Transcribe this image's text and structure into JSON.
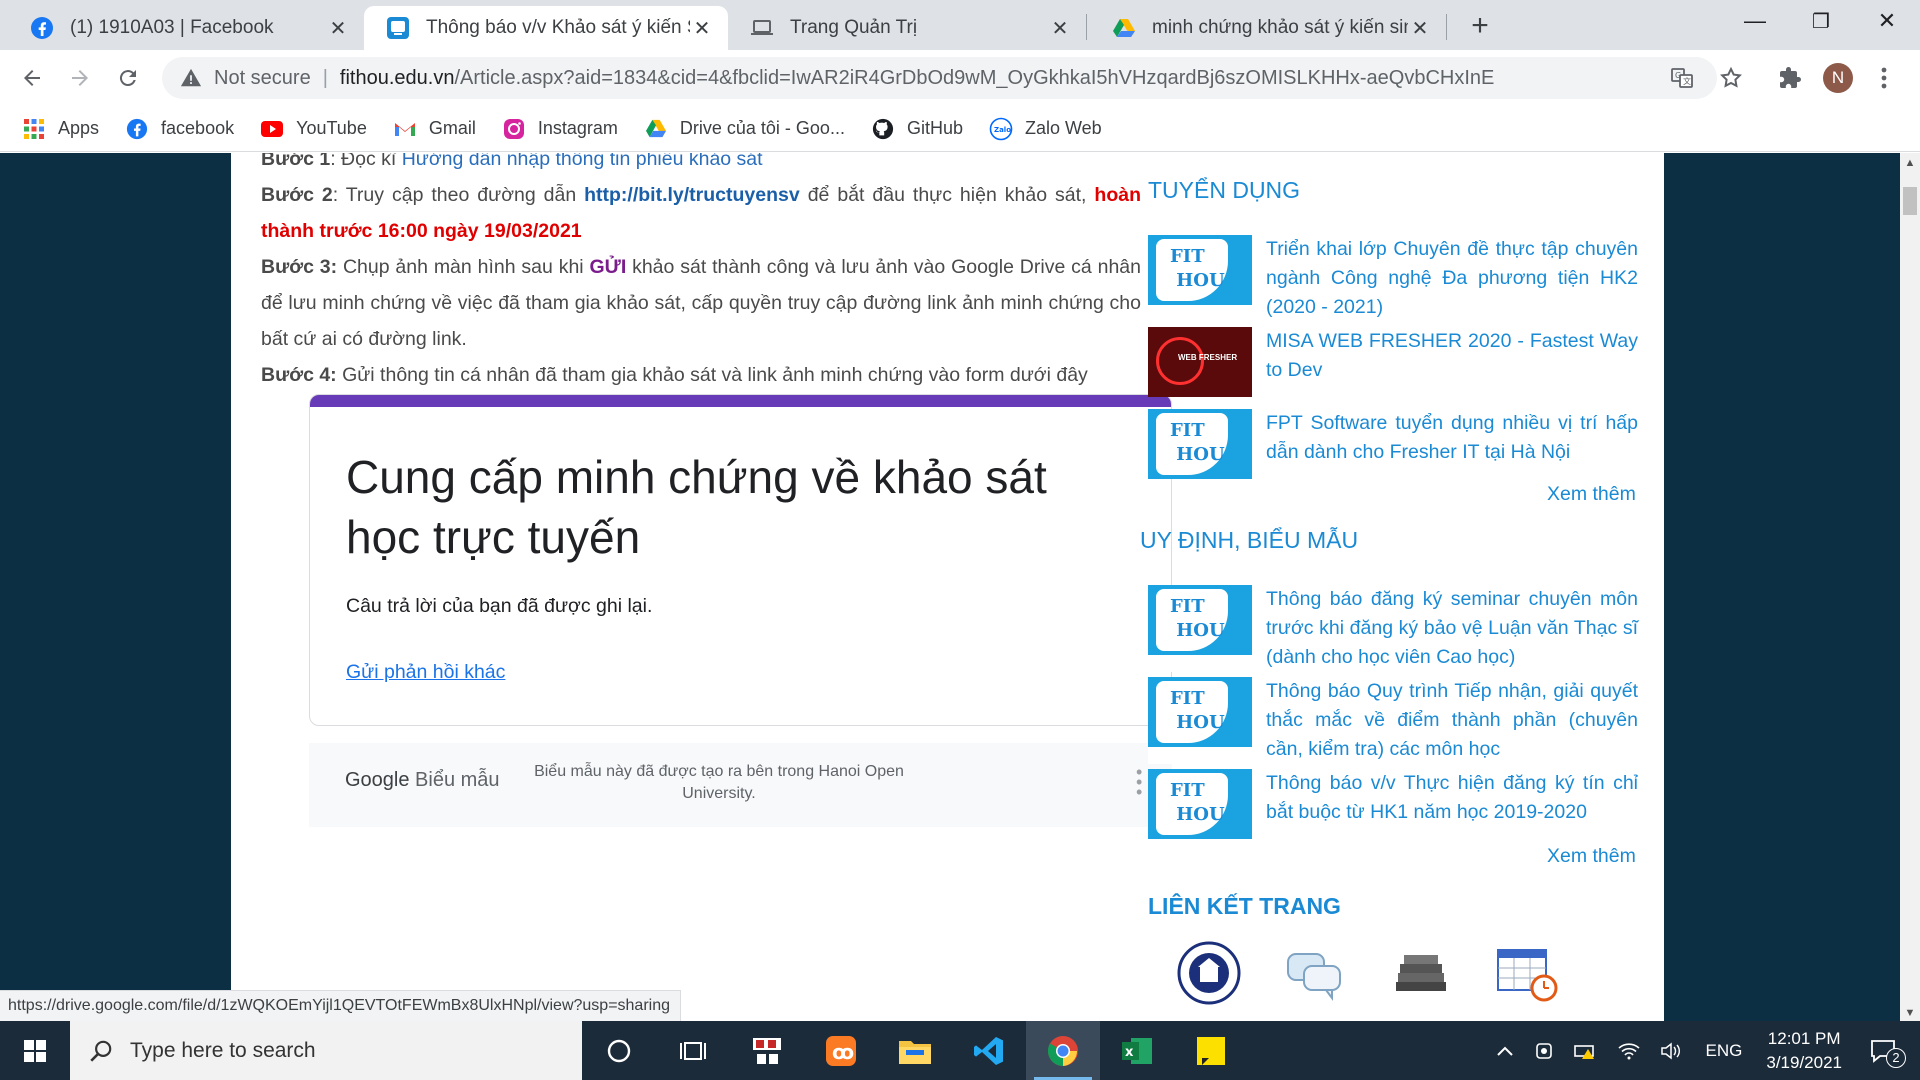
{
  "tabs": [
    {
      "title": "(1) 1910A03 | Facebook",
      "icon": "facebook-icon"
    },
    {
      "title": "Thông báo v/v Khảo sát ý kiến Si",
      "icon": "site-icon"
    },
    {
      "title": "Trang Quản Trị",
      "icon": "laptop-icon"
    },
    {
      "title": "minh chứng khảo sát ý kiến sinh",
      "icon": "google-drive-icon"
    }
  ],
  "omnibox": {
    "security_label": "Not secure",
    "url_host": "fithou.edu.vn",
    "url_rest": "/Article.aspx?aid=1834&cid=4&fbclid=IwAR2iR4GrDbOd9wM_OyGkhkaI5hVHzqardBj6szOMISLKHHx-aeQvbCHxInE"
  },
  "profile_initial": "N",
  "bookmarks": [
    {
      "label": "Apps",
      "icon": "apps-grid-icon"
    },
    {
      "label": "facebook",
      "icon": "facebook-icon"
    },
    {
      "label": "YouTube",
      "icon": "youtube-icon"
    },
    {
      "label": "Gmail",
      "icon": "gmail-icon"
    },
    {
      "label": "Instagram",
      "icon": "instagram-icon"
    },
    {
      "label": "Drive của tôi - Goo...",
      "icon": "google-drive-icon"
    },
    {
      "label": "GitHub",
      "icon": "github-icon"
    },
    {
      "label": "Zalo Web",
      "icon": "zalo-icon"
    }
  ],
  "article": {
    "step1_label": "Bước 1",
    "step1_text": ": Đọc kĩ ",
    "step1_link": "Hướng dẫn nhập thông tin phiếu khảo sát",
    "step2_label": "Bước 2",
    "step2_text": ": Truy cập theo đường dẫn ",
    "step2_link": "http://bit.ly/tructuyensv",
    "step2_text2": " để bắt đầu thực hiện khảo sát, ",
    "step2_deadline": "hoàn thành trước 16:00 ngày 19/03/2021",
    "step3_label": "Bước 3:",
    "step3_text": " Chụp ảnh màn hình sau khi ",
    "step3_em": "GỬI",
    "step3_text2": " khảo sát thành công và lưu ảnh vào Google Drive cá nhân để lưu minh chứng về việc đã tham gia khảo sát, cấp quyền truy cập đường link ảnh minh chứng cho bất cứ ai có đường link.",
    "step4_label": "Bước 4:",
    "step4_text": " Gửi thông tin cá nhân đã tham gia khảo sát và link ảnh minh chứng vào form dưới đây"
  },
  "form": {
    "title": "Cung cấp minh chứng về khảo sát học trực tuyến",
    "message": "Câu trả lời của bạn đã được ghi lại.",
    "link": "Gửi phản hồi khác",
    "logo_google": "Google",
    "logo_forms": " Biểu mẫu",
    "note": "Biểu mẫu này đã được tạo ra bên trong Hanoi Open University.",
    "accent_color": "#673ab7"
  },
  "sidebar": {
    "recruit_heading": "TUYỂN DỤNG",
    "recruit_items": [
      {
        "title": "Triển khai lớp Chuyên đề thực tập chuyên ngành Công nghệ Đa phương tiện HK2 (2020 - 2021)",
        "thumb": "FIT HOU"
      },
      {
        "title": "MISA WEB FRESHER 2020 - Fastest Way to Dev",
        "thumb": "WEB FRESHER"
      },
      {
        "title": "FPT Software tuyển dụng nhiều vị trí hấp dẫn dành cho Fresher IT tại Hà Nội",
        "thumb": "FIT HOU"
      }
    ],
    "more_label": "Xem thêm",
    "rules_heading": "UY ĐỊNH, BIỂU MẪU",
    "rules_items": [
      {
        "title": "Thông báo đăng ký seminar chuyên môn trước khi đăng ký bảo vệ Luận văn Thạc sĩ (dành cho học viên Cao học)",
        "thumb": "FIT HOU"
      },
      {
        "title": "Thông báo Quy trình Tiếp nhận, giải quyết thắc mắc về điểm thành phần (chuyên cần, kiểm tra) các môn học",
        "thumb": "FIT HOU"
      },
      {
        "title": "Thông báo v/v Thực hiện đăng ký tín chỉ bắt buộc từ HK1 năm học 2019-2020",
        "thumb": "FIT HOU"
      }
    ],
    "links_heading": "LIÊN KẾT TRANG",
    "accent_color": "#1a8ad4"
  },
  "status_url": "https://drive.google.com/file/d/1zWQKOEmYijl1QEVTOtFEWmBx8UlxHNpl/view?usp=sharing",
  "taskbar": {
    "search_placeholder": "Type here to search",
    "lang": "ENG",
    "time": "12:01 PM",
    "date": "3/19/2021",
    "notifications": "2"
  }
}
